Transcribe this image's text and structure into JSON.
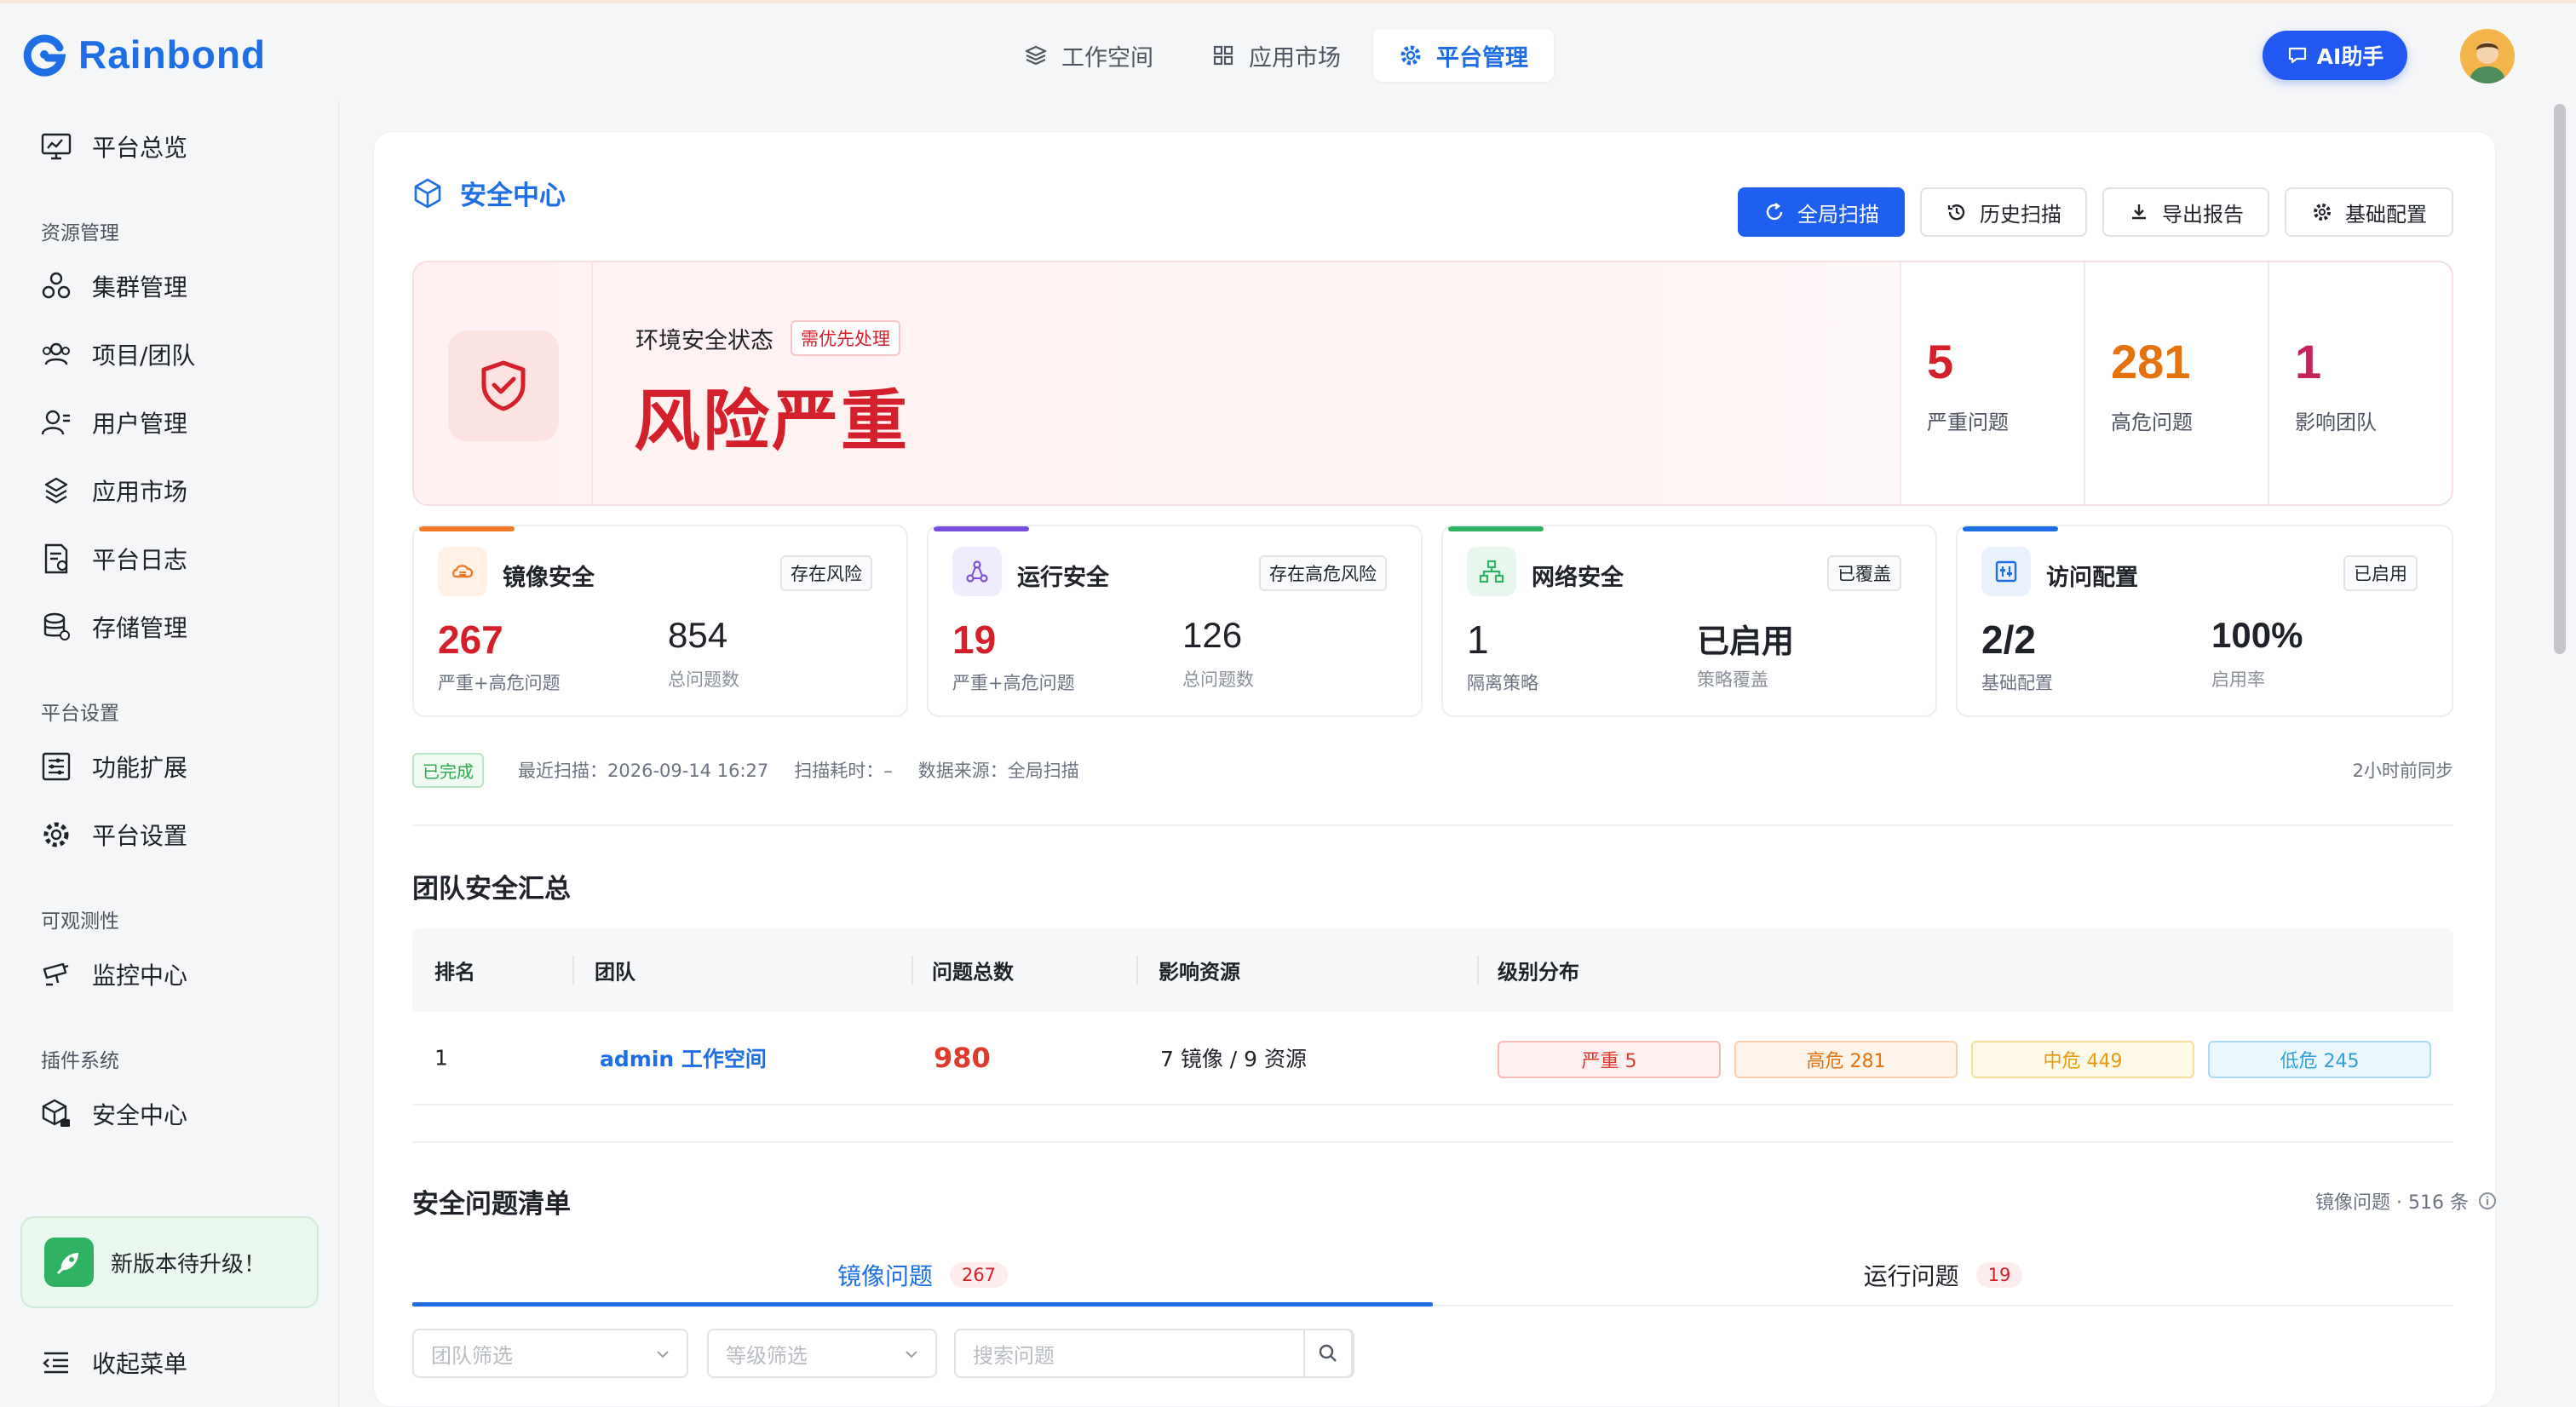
{
  "brand": {
    "name": "Rainbond",
    "color": "#1e6fe6"
  },
  "topnav": {
    "tabs": [
      {
        "label": "工作空间",
        "icon": "layers-icon"
      },
      {
        "label": "应用市场",
        "icon": "grid-icon"
      },
      {
        "label": "平台管理",
        "icon": "gear-icon",
        "active": true
      }
    ],
    "ai_label": "AI助手"
  },
  "sidebar": {
    "overview": "平台总览",
    "groups": {
      "resource": "资源管理",
      "settings": "平台设置",
      "observability": "可观测性",
      "plugins": "插件系统"
    },
    "items": {
      "cluster": "集群管理",
      "team": "项目/团队",
      "user": "用户管理",
      "market": "应用市场",
      "log": "平台日志",
      "storage": "存储管理",
      "extension": "功能扩展",
      "settings": "平台设置",
      "monitor": "监控中心",
      "security": "安全中心"
    },
    "upgrade": "新版本待升级！",
    "collapse": "收起菜单"
  },
  "page": {
    "title": "安全中心",
    "actions": {
      "scan": "全局扫描",
      "history": "历史扫描",
      "export": "导出报告",
      "config": "基础配置"
    }
  },
  "risk": {
    "label": "环境安全状态",
    "tag": "需优先处理",
    "level": "风险严重",
    "stats": [
      {
        "value": "5",
        "label": "严重问题",
        "color": "#d4202b"
      },
      {
        "value": "281",
        "label": "高危问题",
        "color": "#e5720f"
      },
      {
        "value": "1",
        "label": "影响团队",
        "color": "#c5235a"
      }
    ]
  },
  "cards": [
    {
      "name": "镜像安全",
      "tag": "存在风险",
      "v1": "267",
      "l1": "严重+高危问题",
      "v2": "854",
      "l2": "总问题数",
      "accent": "#f07a2a",
      "v1color": "#d4202b"
    },
    {
      "name": "运行安全",
      "tag": "存在高危风险",
      "v1": "19",
      "l1": "严重+高危问题",
      "v2": "126",
      "l2": "总问题数",
      "accent": "#7a4fe0",
      "v1color": "#d4202b"
    },
    {
      "name": "网络安全",
      "tag": "已覆盖",
      "v1": "1",
      "l1": "隔离策略",
      "v2": "已启用",
      "l2": "策略覆盖",
      "accent": "#2fb262",
      "v1color": "#1f2329"
    },
    {
      "name": "访问配置",
      "tag": "已启用",
      "v1": "2/2",
      "l1": "基础配置",
      "v2": "100%",
      "l2": "启用率",
      "accent": "#1e6fe6",
      "v1color": "#1f2329"
    }
  ],
  "scan": {
    "status": "已完成",
    "last": "最近扫描：2026-09-14 16:27",
    "duration": "扫描耗时：–",
    "source": "数据来源：全局扫描",
    "sync": "2小时前同步"
  },
  "team_summary": {
    "title": "团队安全汇总",
    "headers": [
      "排名",
      "团队",
      "问题总数",
      "影响资源",
      "级别分布"
    ],
    "rows": [
      {
        "rank": "1",
        "team": "admin 工作空间",
        "total": "980",
        "resources": "7 镜像 / 9 资源",
        "levels": [
          "严重 5",
          "高危 281",
          "中危 449",
          "低危 245"
        ]
      }
    ]
  },
  "issues": {
    "title": "安全问题清单",
    "meta": "镜像问题 · 516 条",
    "tabs": [
      {
        "label": "镜像问题",
        "count": "267"
      },
      {
        "label": "运行问题",
        "count": "19"
      }
    ],
    "filters": {
      "team": "团队筛选",
      "level": "等级筛选",
      "search": "搜索问题"
    }
  }
}
